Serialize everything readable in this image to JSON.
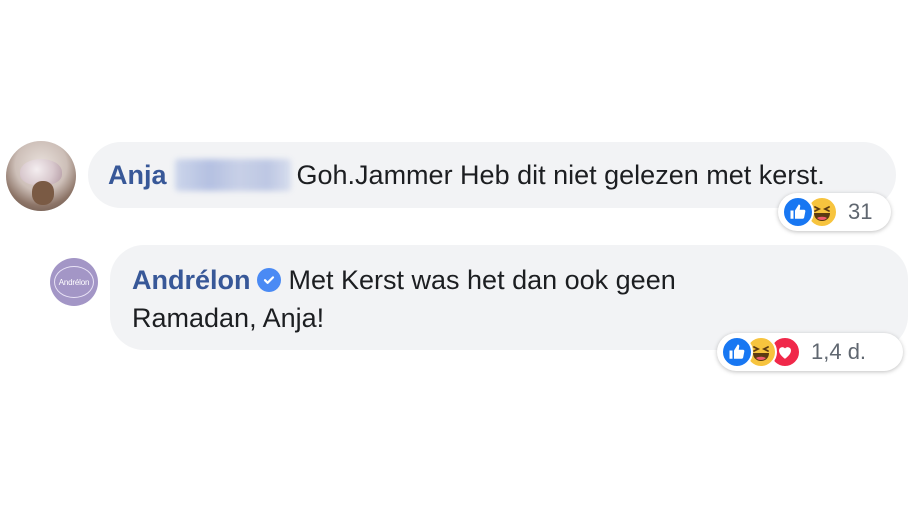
{
  "comment1": {
    "author": "Anja",
    "text": "Goh.Jammer Heb dit niet gelezen met kerst.",
    "reactions": [
      "like-icon",
      "haha-icon"
    ],
    "reaction_count": "31"
  },
  "comment2": {
    "author": "Andrélon",
    "avatar_text": "Andrélon",
    "verified": true,
    "text_line1": "Met Kerst was het dan ook geen",
    "text_line2": "Ramadan, Anja!",
    "reactions": [
      "like-icon",
      "haha-icon",
      "love-icon"
    ],
    "reaction_count": "1,4 d."
  },
  "colors": {
    "author_name": "#385898",
    "bubble_bg": "#f2f3f5",
    "like": "#1877f2",
    "haha": "#f7c43e",
    "love": "#f0284a",
    "verified": "#4a8af4"
  }
}
